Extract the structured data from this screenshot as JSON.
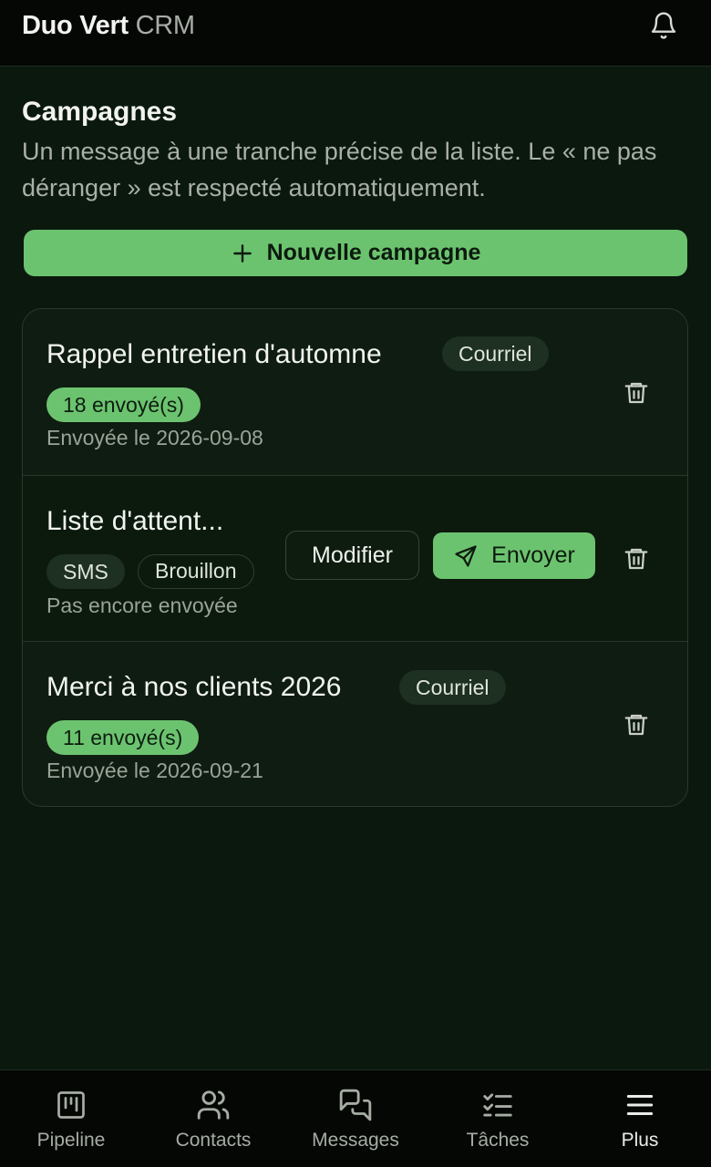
{
  "app": {
    "brand_strong": "Duo Vert",
    "brand_light": "CRM"
  },
  "page": {
    "title": "Campagnes",
    "description": "Un message à une tranche précise de la liste. Le « ne pas déranger » est respecté automatiquement.",
    "new_button": "Nouvelle campagne"
  },
  "campaigns": [
    {
      "name": "Rappel entretien d'automne",
      "channel": "Courriel",
      "sent_badge": "18 envoyé(s)",
      "status_text": "Envoyée le 2026-09-08"
    },
    {
      "name": "Liste d'attent...",
      "channel": "SMS",
      "state": "Brouillon",
      "status_text": "Pas encore envoyée",
      "edit_label": "Modifier",
      "send_label": "Envoyer"
    },
    {
      "name": "Merci à nos clients 2026",
      "channel": "Courriel",
      "sent_badge": "11 envoyé(s)",
      "status_text": "Envoyée le 2026-09-21"
    }
  ],
  "nav": [
    {
      "label": "Pipeline",
      "icon": "kanban-icon"
    },
    {
      "label": "Contacts",
      "icon": "users-icon"
    },
    {
      "label": "Messages",
      "icon": "chat-icon"
    },
    {
      "label": "Tâches",
      "icon": "checklist-icon"
    },
    {
      "label": "Plus",
      "icon": "menu-icon"
    }
  ],
  "colors": {
    "accent": "#6cc36f",
    "background": "#0b180e",
    "header": "#040704"
  }
}
